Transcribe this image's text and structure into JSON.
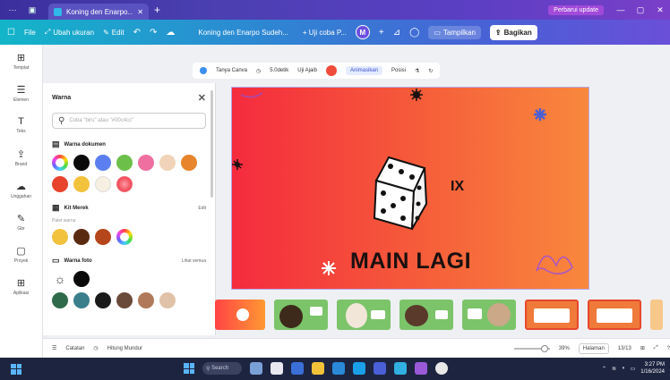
{
  "browser": {
    "tab_title": "Koning den Enarpo...",
    "new_tab": "+",
    "update_label": "Perbarui update",
    "window_controls": [
      "—",
      "▢",
      "✕"
    ]
  },
  "topbar": {
    "file_label": "File",
    "resize_label": "Ubah ukuran",
    "edit_label": "Edit",
    "doc_name": "Koning den Enarpo Sudeh...",
    "size_label": "+ Uji coba P...",
    "avatar_letter": "M",
    "template_label": "Tampilkan",
    "share_label": "Bagikan"
  },
  "rail": {
    "items": [
      {
        "icon": "⊞",
        "label": "Templat"
      },
      {
        "icon": "☰",
        "label": "Elemen"
      },
      {
        "icon": "T",
        "label": "Teks"
      },
      {
        "icon": "⇪",
        "label": "Brand"
      },
      {
        "icon": "☁",
        "label": "Unggahan"
      },
      {
        "icon": "✎",
        "label": "Gbr"
      },
      {
        "icon": "▢",
        "label": "Proyek"
      },
      {
        "icon": "⊞",
        "label": "Aplikasi"
      }
    ]
  },
  "panel": {
    "title": "Warna",
    "close": "✕",
    "search_placeholder": "Coba \"biru\" atau \"#00c4cc\"",
    "doc_colors_title": "Warna dokumen",
    "brand_kit_title": "Kit Merek",
    "brand_kit_link": "Edit",
    "brand_sub": "Palet warna",
    "default_colors_title": "Warna foto",
    "default_colors_link": "Lihat semua",
    "doc_colors": [
      "#0a0a0a",
      "#5b7ff0",
      "#6cc04a",
      "#ef6fa0",
      "#f0d3b8",
      "#e8842c",
      "#e8432d",
      "#f3c23d",
      "#f7f0e2"
    ],
    "brand_colors": [
      "#f3c23d",
      "#5a2a10",
      "#b5461c"
    ],
    "photo_colors": [
      "#2f6b4a",
      "#3a7e8c",
      "#1a1a1a",
      "#6a4a3a",
      "#b07a5a",
      "#e0c2a8"
    ]
  },
  "context": {
    "font_label": "Tanya Canva",
    "timer_label": "5.0detik",
    "grid_label": "Uji Ajaib",
    "anim_label": "Animasikan",
    "position_label": "Posisi"
  },
  "slide": {
    "title": "MAIN LAGI",
    "small_text": "IX"
  },
  "thumbnails": [
    {
      "kind": "t1"
    },
    {
      "kind": "green"
    },
    {
      "kind": "green"
    },
    {
      "kind": "green"
    },
    {
      "kind": "green"
    },
    {
      "kind": "orange"
    },
    {
      "kind": "orange"
    }
  ],
  "status": {
    "notes_label": "Catatan",
    "timer_label": "Hitung Mundur",
    "zoom": "39%",
    "pages_label": "Halaman",
    "page_count": "13/13"
  },
  "taskbar": {
    "search_label": "Search",
    "time": "3:27 PM",
    "date": "1/16/2024"
  },
  "colors": {
    "accent": "#5b3fc4",
    "canvas_left": "#f52b3e",
    "canvas_right": "#f9883d"
  }
}
